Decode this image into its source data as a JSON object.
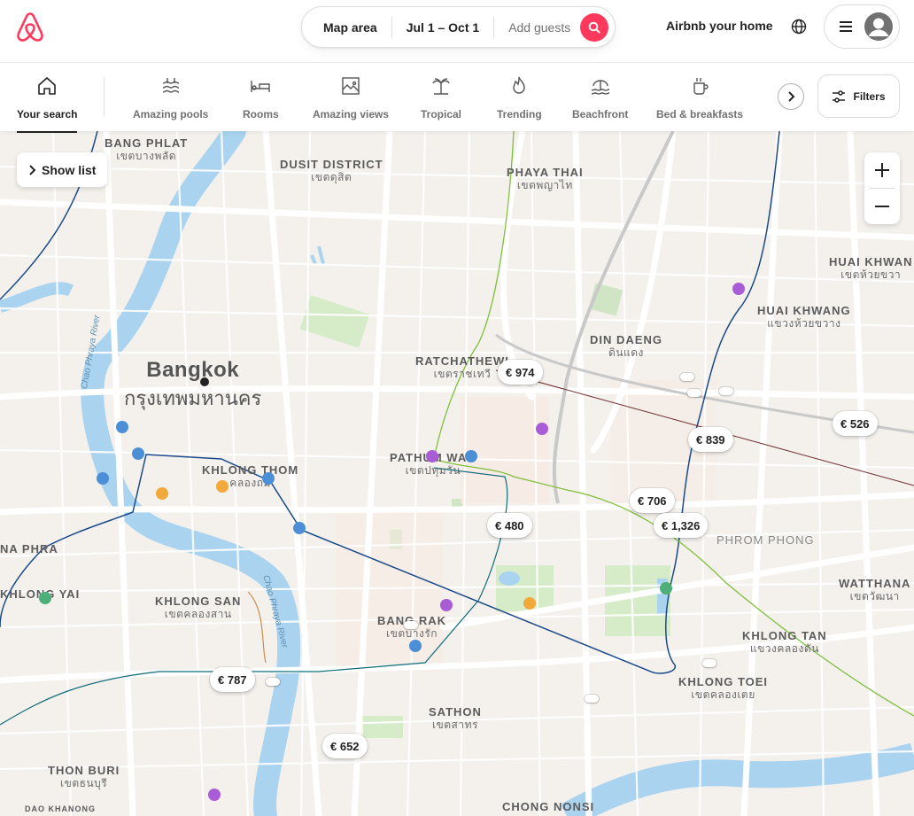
{
  "header": {
    "search": {
      "location": "Map area",
      "dates": "Jul 1 – Oct 1",
      "guests_placeholder": "Add guests"
    },
    "host_link": "Airbnb your home",
    "colors": {
      "brand": "#ff385c"
    }
  },
  "categories": [
    {
      "label": "Your search",
      "icon": "home-icon",
      "active": true
    },
    {
      "label": "Amazing pools",
      "icon": "pool-icon"
    },
    {
      "label": "Rooms",
      "icon": "bed-icon"
    },
    {
      "label": "Amazing views",
      "icon": "view-icon"
    },
    {
      "label": "Tropical",
      "icon": "palm-icon"
    },
    {
      "label": "Trending",
      "icon": "flame-icon"
    },
    {
      "label": "Beachfront",
      "icon": "beach-icon"
    },
    {
      "label": "Bed & breakfasts",
      "icon": "coffee-icon"
    }
  ],
  "filters_label": "Filters",
  "map": {
    "show_list": "Show list",
    "city": {
      "en": "Bangkok",
      "th": "กรุงเทพมหานคร"
    },
    "districts": [
      {
        "en": "BANG PHLAT",
        "th": "เขตบางพลัด"
      },
      {
        "en": "DUSIT DISTRICT",
        "th": "เขตดุสิต"
      },
      {
        "en": "PHAYA THAI",
        "th": "เขตพญาไท"
      },
      {
        "en": "HUAI KHWAN",
        "th": "เขตห้วยขวา"
      },
      {
        "en": "HUAI KHWANG",
        "th": "แขวงห้วยขวาง"
      },
      {
        "en": "DIN DAENG",
        "th": "ดินแดง"
      },
      {
        "en": "RATCHATHEWI",
        "th": "เขตราชเทวี"
      },
      {
        "en": "PATHUM WAN",
        "th": "เขตปทุมวัน"
      },
      {
        "en": "KHLONG THOM",
        "th": "คลองถม"
      },
      {
        "en": "KHLONG SAN",
        "th": "เขตคลองสาน"
      },
      {
        "en": "BANG RAK",
        "th": "เขตบางรัก"
      },
      {
        "en": "PHROM PHONG",
        "th": ""
      },
      {
        "en": "WATTHANA",
        "th": "เขตวัฒนา"
      },
      {
        "en": "KHLONG TAN",
        "th": "แขวงคลองตัน"
      },
      {
        "en": "KHLONG TOEI",
        "th": "เขตคลองเตย"
      },
      {
        "en": "SATHON",
        "th": "เขตสาทร"
      },
      {
        "en": "THON BURI",
        "th": "เขตธนบุรี"
      },
      {
        "en": "CHONG NONSI",
        "th": ""
      },
      {
        "en": "NA PHRA",
        "th": ""
      },
      {
        "en": "KHLONG YAI",
        "th": ""
      },
      {
        "en": "DAO KHANONG",
        "th": ""
      }
    ],
    "river_label": "Chao Phraya River",
    "prices": [
      "€ 974",
      "€ 526",
      "€ 839",
      "€ 706",
      "€ 1,326",
      "€ 480",
      "€ 787",
      "€ 652"
    ]
  }
}
